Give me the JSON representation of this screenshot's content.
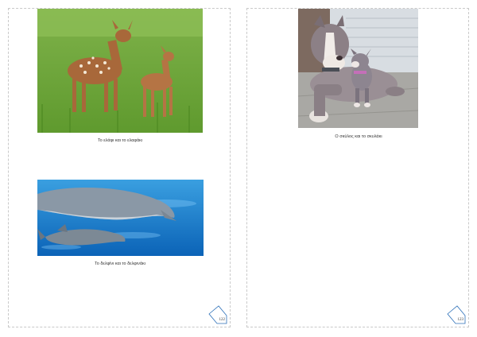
{
  "pages": [
    {
      "number": "122",
      "images": [
        {
          "subject": "deer-photo",
          "caption": "Το ελάφι και το ελαφάκι"
        },
        {
          "subject": "dolphin-photo",
          "caption": "Το δελφίνι και το δελφινάκι"
        }
      ]
    },
    {
      "number": "123",
      "images": [
        {
          "subject": "dog-photo",
          "caption": "Ο σκύλος και το σκυλάκι"
        }
      ]
    }
  ]
}
